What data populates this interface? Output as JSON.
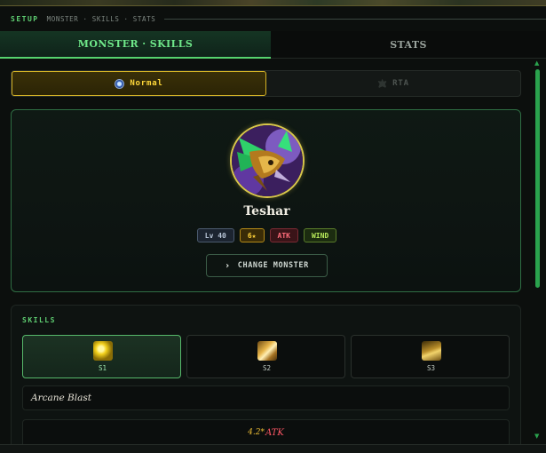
{
  "header": {
    "setup_label": "SETUP",
    "breadcrumb": "MONSTER · SKILLS · STATS"
  },
  "tabs": [
    {
      "label": "MONSTER · SKILLS",
      "active": true
    },
    {
      "label": "STATS",
      "active": false
    }
  ],
  "mode_toggle": {
    "normal_label": "Normal",
    "rta_label": "RTA",
    "selected": "Normal",
    "normal_icon": "normal-mode-icon",
    "rta_icon": "rta-mode-icon"
  },
  "monster": {
    "name": "Teshar",
    "level": "Lv 40",
    "stars": "6★",
    "type": "ATK",
    "element": "WIND",
    "change_label": "CHANGE MONSTER",
    "change_icon": "chevron-right-icon",
    "portrait_icon": "monster-portrait"
  },
  "skills": {
    "title": "SKILLS",
    "items": [
      {
        "label": "S1",
        "icon": "skill-1-icon",
        "selected": true
      },
      {
        "label": "S2",
        "icon": "skill-2-icon",
        "selected": false
      },
      {
        "label": "S3",
        "icon": "skill-3-icon",
        "selected": false
      }
    ],
    "selected_name": "Arcane Blast",
    "formula": {
      "multiplier": "4.2*",
      "stat": "ATK"
    }
  },
  "colors": {
    "accent_green": "#56d46e",
    "gold": "#ffd83a",
    "atk_red": "#ff5766"
  }
}
